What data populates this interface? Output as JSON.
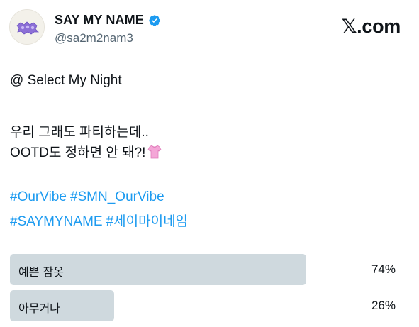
{
  "header": {
    "display_name": "SAY MY NAME",
    "handle": "@sa2m2nam3",
    "brand": ".com",
    "brand_x": "𝕏",
    "verified": true,
    "verified_color": "#1d9bf0"
  },
  "tweet": {
    "line1": "@ Select My Night",
    "line2": "우리 그래도 파티하는데..",
    "line3": "OOTD도 정하면 안 돼?!",
    "line3_emoji_icon": "shirt-icon",
    "hashtags_row1": [
      "#OurVibe",
      "#SMN_OurVibe"
    ],
    "hashtags_row2": [
      "#SAYMYNAME",
      "#세이마이네임"
    ]
  },
  "poll": {
    "options": [
      {
        "label": "예쁜 잠옷",
        "percent_text": "74%",
        "percent": 74
      },
      {
        "label": "아무거나",
        "percent_text": "26%",
        "percent": 26
      }
    ]
  },
  "colors": {
    "hashtag": "#1d9bf0",
    "poll_bar": "#cfd9de",
    "text": "#0f1419",
    "muted": "#536471"
  }
}
